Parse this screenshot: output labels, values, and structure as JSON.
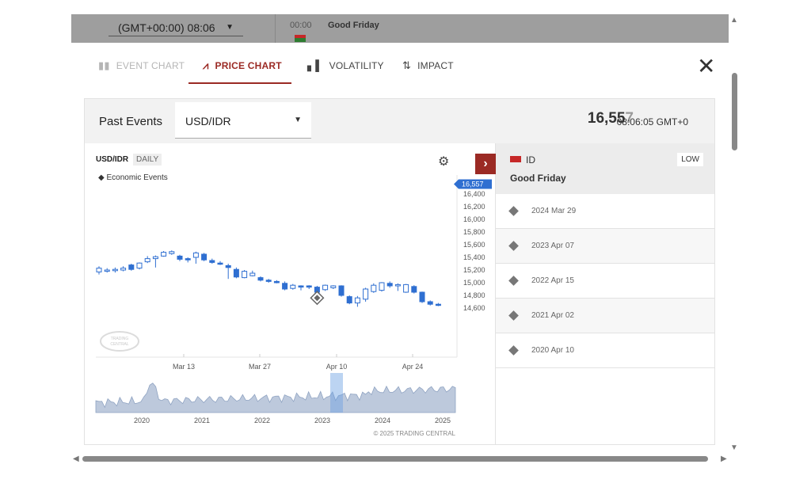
{
  "background": {
    "timezone": "(GMT+00:00) 08:06",
    "event_time": "00:00",
    "event_name": "Good Friday"
  },
  "tabs": [
    {
      "label": "EVENT CHART",
      "icon": "bar-chart-icon",
      "state": "disabled"
    },
    {
      "label": "PRICE CHART",
      "icon": "candlestick-icon",
      "state": "active"
    },
    {
      "label": "VOLATILITY",
      "icon": "bars-icon",
      "state": "normal"
    },
    {
      "label": "IMPACT",
      "icon": "up-down-arrows-icon",
      "state": "normal"
    }
  ],
  "panel": {
    "title": "Past Events",
    "pair": "USD/IDR",
    "price_main": "16,55",
    "price_dim": "7",
    "time": "08:06:05 GMT+0"
  },
  "chart": {
    "symbol": "USD/IDR",
    "frequency": "DAILY",
    "legend": "Economic Events",
    "current_label": "16,557",
    "copyright": "© 2025 TRADING CENTRAL",
    "watermark": "TRADING CENTRAL",
    "accent": "#2f6fd1"
  },
  "chart_data": {
    "type": "candlestick",
    "y_ticks": [
      "16,400",
      "16,200",
      "16,000",
      "15,800",
      "15,600",
      "15,400",
      "15,200",
      "15,000",
      "14,800",
      "14,600"
    ],
    "ylim": [
      14,
      560,
      16,
      600
    ],
    "x_ticks": [
      "Mar 13",
      "Mar 27",
      "Apr 10",
      "Apr 24"
    ],
    "candles": [
      {
        "open": 15170,
        "close": 15230,
        "high": 15260,
        "low": 15130
      },
      {
        "open": 15180,
        "close": 15200,
        "high": 15230,
        "low": 15160
      },
      {
        "open": 15190,
        "close": 15210,
        "high": 15240,
        "low": 15160
      },
      {
        "open": 15200,
        "close": 15230,
        "high": 15260,
        "low": 15180
      },
      {
        "open": 15280,
        "close": 15210,
        "high": 15300,
        "low": 15190
      },
      {
        "open": 15230,
        "close": 15310,
        "high": 15320,
        "low": 15210
      },
      {
        "open": 15330,
        "close": 15380,
        "high": 15420,
        "low": 15310
      },
      {
        "open": 15380,
        "close": 15410,
        "high": 15430,
        "low": 15240
      },
      {
        "open": 15420,
        "close": 15480,
        "high": 15500,
        "low": 15410
      },
      {
        "open": 15460,
        "close": 15490,
        "high": 15510,
        "low": 15440
      },
      {
        "open": 15420,
        "close": 15370,
        "high": 15440,
        "low": 15340
      },
      {
        "open": 15380,
        "close": 15360,
        "high": 15400,
        "low": 15320
      },
      {
        "open": 15400,
        "close": 15470,
        "high": 15490,
        "low": 15300
      },
      {
        "open": 15450,
        "close": 15360,
        "high": 15470,
        "low": 15340
      },
      {
        "open": 15350,
        "close": 15320,
        "high": 15380,
        "low": 15300
      },
      {
        "open": 15310,
        "close": 15300,
        "high": 15340,
        "low": 15280
      },
      {
        "open": 15270,
        "close": 15240,
        "high": 15300,
        "low": 15060
      },
      {
        "open": 15210,
        "close": 15090,
        "high": 15240,
        "low": 15070
      },
      {
        "open": 15080,
        "close": 15180,
        "high": 15200,
        "low": 15070
      },
      {
        "open": 15110,
        "close": 15150,
        "high": 15190,
        "low": 15100
      },
      {
        "open": 15080,
        "close": 15040,
        "high": 15100,
        "low": 15020
      },
      {
        "open": 15040,
        "close": 15020,
        "high": 15060,
        "low": 15000
      },
      {
        "open": 15020,
        "close": 15000,
        "high": 15040,
        "low": 14990
      },
      {
        "open": 14990,
        "close": 14900,
        "high": 15020,
        "low": 14880
      },
      {
        "open": 14910,
        "close": 14960,
        "high": 14980,
        "low": 14890
      },
      {
        "open": 14950,
        "close": 14930,
        "high": 14960,
        "low": 14880
      },
      {
        "open": 14950,
        "close": 14930,
        "high": 14960,
        "low": 14900
      },
      {
        "open": 14930,
        "close": 14850,
        "high": 14950,
        "low": 14840
      },
      {
        "open": 14890,
        "close": 14960,
        "high": 14970,
        "low": 14870
      },
      {
        "open": 14920,
        "close": 14950,
        "high": 14960,
        "low": 14900
      },
      {
        "open": 14950,
        "close": 14800,
        "high": 14960,
        "low": 14780
      },
      {
        "open": 14780,
        "close": 14680,
        "high": 14800,
        "low": 14660
      },
      {
        "open": 14680,
        "close": 14760,
        "high": 14790,
        "low": 14620
      },
      {
        "open": 14740,
        "close": 14900,
        "high": 14920,
        "low": 14700
      },
      {
        "open": 14860,
        "close": 14960,
        "high": 14990,
        "low": 14840
      },
      {
        "open": 14880,
        "close": 15000,
        "high": 15010,
        "low": 14860
      },
      {
        "open": 14990,
        "close": 14950,
        "high": 15020,
        "low": 14920
      },
      {
        "open": 14950,
        "close": 14970,
        "high": 14990,
        "low": 14870
      },
      {
        "open": 14850,
        "close": 14970,
        "high": 14980,
        "low": 14840
      },
      {
        "open": 14940,
        "close": 14850,
        "high": 14960,
        "low": 14830
      },
      {
        "open": 14850,
        "close": 14700,
        "high": 14860,
        "low": 14680
      },
      {
        "open": 14700,
        "close": 14660,
        "high": 14720,
        "low": 14640
      },
      {
        "open": 14660,
        "close": 14650,
        "high": 14680,
        "low": 14630
      }
    ],
    "event_marker_index": 27,
    "navigator_x_ticks": [
      "2020",
      "2021",
      "2022",
      "2023",
      "2024",
      "2025"
    ]
  },
  "side": {
    "country": "ID",
    "impact": "LOW",
    "event": "Good Friday",
    "rows": [
      "2024 Mar 29",
      "2023 Apr 07",
      "2022 Apr 15",
      "2021 Apr 02",
      "2020 Apr 10"
    ]
  }
}
